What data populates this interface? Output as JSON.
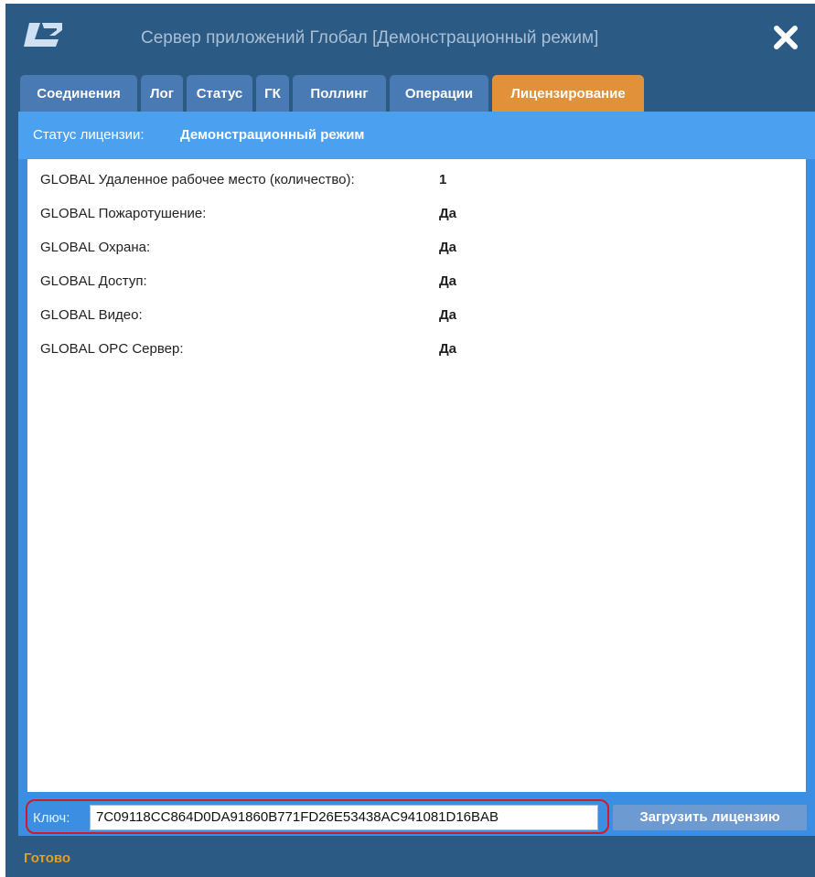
{
  "window": {
    "title": "Сервер приложений Глобал [Демонстрационный режим]",
    "logo_icon": "app-logo",
    "close_icon": "close-icon"
  },
  "tabs": [
    {
      "label": "Соединения",
      "active": false
    },
    {
      "label": "Лог",
      "active": false
    },
    {
      "label": "Статус",
      "active": false
    },
    {
      "label": "ГК",
      "active": false
    },
    {
      "label": "Поллинг",
      "active": false
    },
    {
      "label": "Операции",
      "active": false
    },
    {
      "label": "Лицензирование",
      "active": true
    }
  ],
  "license": {
    "status_label": "Статус лицензии:",
    "status_value": "Демонстрационный режим",
    "rows": [
      {
        "label": "GLOBAL Удаленное рабочее место (количество):",
        "value": "1"
      },
      {
        "label": "GLOBAL Пожаротушение:",
        "value": "Да"
      },
      {
        "label": "GLOBAL Охрана:",
        "value": "Да"
      },
      {
        "label": "GLOBAL Доступ:",
        "value": "Да"
      },
      {
        "label": "GLOBAL Видео:",
        "value": "Да"
      },
      {
        "label": "GLOBAL OPC Сервер:",
        "value": "Да"
      }
    ],
    "key_label": "Ключ:",
    "key_value": "7C09118CC864D0DA91860B771FD26E53438AC941081D16BAB",
    "load_button": "Загрузить лицензию"
  },
  "footer": {
    "status": "Готово"
  },
  "colors": {
    "window_bg": "#2b5a84",
    "tab_bg": "#4a7ab3",
    "tab_active_bg": "#e0913a",
    "panel_bg": "#3c8ee2",
    "highlight": "#d01a2a",
    "footer_status": "#e89d22"
  }
}
